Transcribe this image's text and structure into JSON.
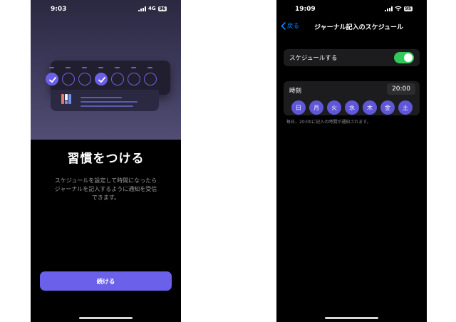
{
  "left_screen": {
    "status": {
      "time": "9:03",
      "network": "4G",
      "battery": "96"
    },
    "title": "習慣をつける",
    "description": "スケジュールを設定して時間になったらジャーナルを記入するように通知を受信できます。",
    "continue_label": "続ける",
    "habit_days_checked": [
      true,
      false,
      false,
      true,
      false,
      false,
      false
    ]
  },
  "right_screen": {
    "status": {
      "time": "19:09",
      "battery": "95"
    },
    "nav": {
      "back_label": "戻る",
      "title": "ジャーナル記入のスケジュール"
    },
    "schedule_toggle": {
      "label": "スケジュールする",
      "enabled": true
    },
    "time_row": {
      "label": "時刻",
      "value": "20:00"
    },
    "weekdays": [
      {
        "label": "日",
        "selected": true
      },
      {
        "label": "月",
        "selected": true
      },
      {
        "label": "火",
        "selected": true
      },
      {
        "label": "水",
        "selected": true
      },
      {
        "label": "木",
        "selected": true
      },
      {
        "label": "金",
        "selected": true
      },
      {
        "label": "土",
        "selected": true
      }
    ],
    "footnote": "毎日、20:00に記入の時間が通知されます。"
  },
  "colors": {
    "accent": "#6b60ea",
    "toggle_on": "#34c759",
    "link": "#0a84ff",
    "weekday_chip": "#5f57d8"
  },
  "icons": [
    "wifi-icon",
    "signal-icon",
    "battery-icon",
    "check-icon",
    "chevron-left-icon",
    "app-logo-icon"
  ]
}
